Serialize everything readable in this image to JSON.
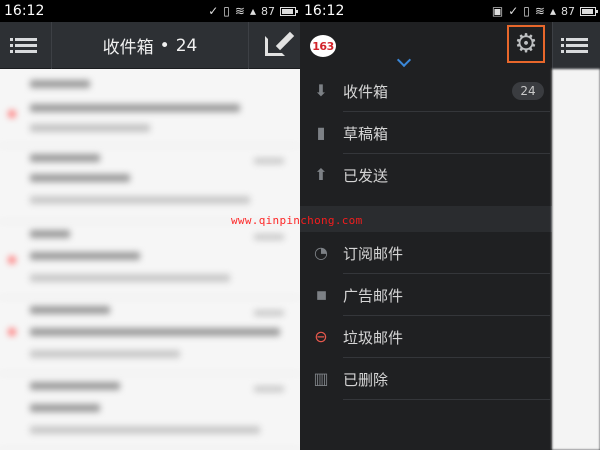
{
  "status_bar": {
    "time_left": "16:12",
    "time_right": "16:12",
    "battery": "87"
  },
  "left_screen": {
    "title": "收件箱",
    "separator": "•",
    "count": "24"
  },
  "drawer": {
    "logo_text": "163",
    "items": [
      {
        "label": "收件箱",
        "badge": "24",
        "icon": "download-arrow-icon"
      },
      {
        "label": "草稿箱",
        "icon": "document-icon"
      },
      {
        "label": "已发送",
        "icon": "upload-arrow-icon"
      },
      {
        "label": "订阅邮件",
        "icon": "rss-icon"
      },
      {
        "label": "广告邮件",
        "icon": "tag-icon"
      },
      {
        "label": "垃圾邮件",
        "icon": "block-icon"
      },
      {
        "label": "已删除",
        "icon": "trash-icon"
      }
    ]
  },
  "watermark": "www.qinpinchong.com",
  "colors": {
    "accent_orange": "#e8672b",
    "chevron_blue": "#3a87d8",
    "logo_red": "#d2232a"
  }
}
